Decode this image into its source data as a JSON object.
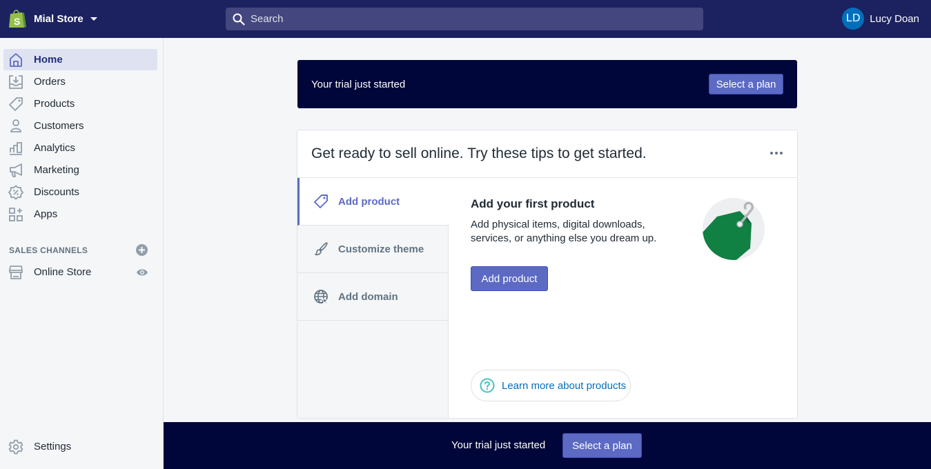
{
  "topbar": {
    "store_name": "Mial Store",
    "search_placeholder": "Search",
    "user_initials": "LD",
    "user_name": "Lucy Doan"
  },
  "sidebar": {
    "items": [
      {
        "label": "Home",
        "icon": "home-icon",
        "active": true
      },
      {
        "label": "Orders",
        "icon": "orders-icon"
      },
      {
        "label": "Products",
        "icon": "tag-icon"
      },
      {
        "label": "Customers",
        "icon": "person-icon"
      },
      {
        "label": "Analytics",
        "icon": "bar-chart-icon"
      },
      {
        "label": "Marketing",
        "icon": "megaphone-icon"
      },
      {
        "label": "Discounts",
        "icon": "discount-icon"
      },
      {
        "label": "Apps",
        "icon": "apps-icon"
      }
    ],
    "sales_channels_title": "SALES CHANNELS",
    "channels": [
      {
        "label": "Online Store",
        "icon": "store-icon"
      }
    ],
    "settings_label": "Settings"
  },
  "trial_banner": {
    "text": "Your trial just started",
    "button": "Select a plan"
  },
  "tips_card": {
    "title": "Get ready to sell online. Try these tips to get started.",
    "tabs": [
      {
        "label": "Add product",
        "icon": "tag-icon",
        "active": true
      },
      {
        "label": "Customize theme",
        "icon": "brush-icon"
      },
      {
        "label": "Add domain",
        "icon": "globe-icon"
      }
    ],
    "content": {
      "heading": "Add your first product",
      "description": "Add physical items, digital downloads, services, or anything else you dream up.",
      "button": "Add product",
      "learn_more": "Learn more about products"
    }
  },
  "bottom_banner": {
    "text": "Your trial just started",
    "button": "Select a plan"
  },
  "colors": {
    "topbar": "#1c2260",
    "banner": "#000639",
    "primary": "#5c6ac4",
    "link": "#006fbb",
    "tag_green": "#108043"
  }
}
